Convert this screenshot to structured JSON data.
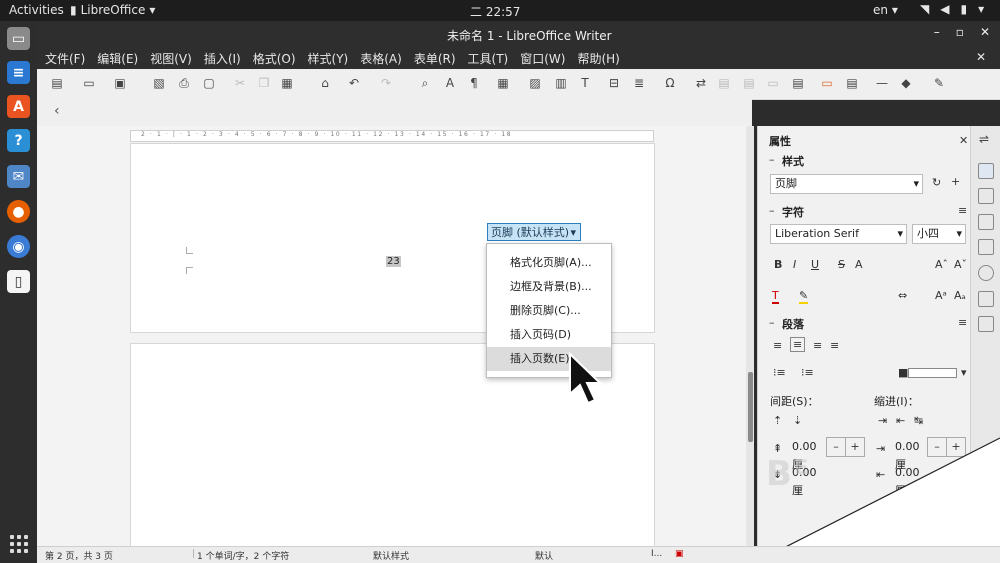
{
  "topbar": {
    "activities": "Activities",
    "app": "LibreOffice",
    "clock": "二 22:57",
    "lang": "en"
  },
  "window": {
    "title": "未命名 1 - LibreOffice Writer"
  },
  "menu": [
    "文件(F)",
    "编辑(E)",
    "视图(V)",
    "插入(I)",
    "格式(O)",
    "样式(Y)",
    "表格(A)",
    "表单(R)",
    "工具(T)",
    "窗口(W)",
    "帮助(H)"
  ],
  "ruler_numbers": "2 · 1 · | · 1 · 2 · 3 · 4 · 5 · 6 · 7 · 8 · 9 · 10 · 11 · 12 · 13 · 14 · 15 · 16 · 17 · 18",
  "document": {
    "footer_button": "页脚 (默认样式)",
    "page_field": "23"
  },
  "context_menu": [
    "格式化页脚(A)...",
    "边框及背景(B)...",
    "删除页脚(C)...",
    "插入页码(D)",
    "插入页数(E)"
  ],
  "sidebar": {
    "title": "属性",
    "styles_section": "样式",
    "style_value": "页脚",
    "char_section": "字符",
    "font_name": "Liberation Serif",
    "font_size": "小四",
    "para_section": "段落",
    "spacing_label": "间距(S)：",
    "indent_label": "缩进(I)：",
    "spacing_value1": "0.00 厘",
    "spacing_value2": "0.00 厘",
    "indent_value1": "0.00 厘",
    "indent_value2": "0.00 厘"
  },
  "status": {
    "page": "第 2 页，共 3 页",
    "words": "1 个单词/字，2 个字符",
    "page_style": "默认样式",
    "lang": "默认"
  },
  "colors": {
    "accent": "#c7e4f7",
    "ubuntu_orange": "#e95420"
  }
}
